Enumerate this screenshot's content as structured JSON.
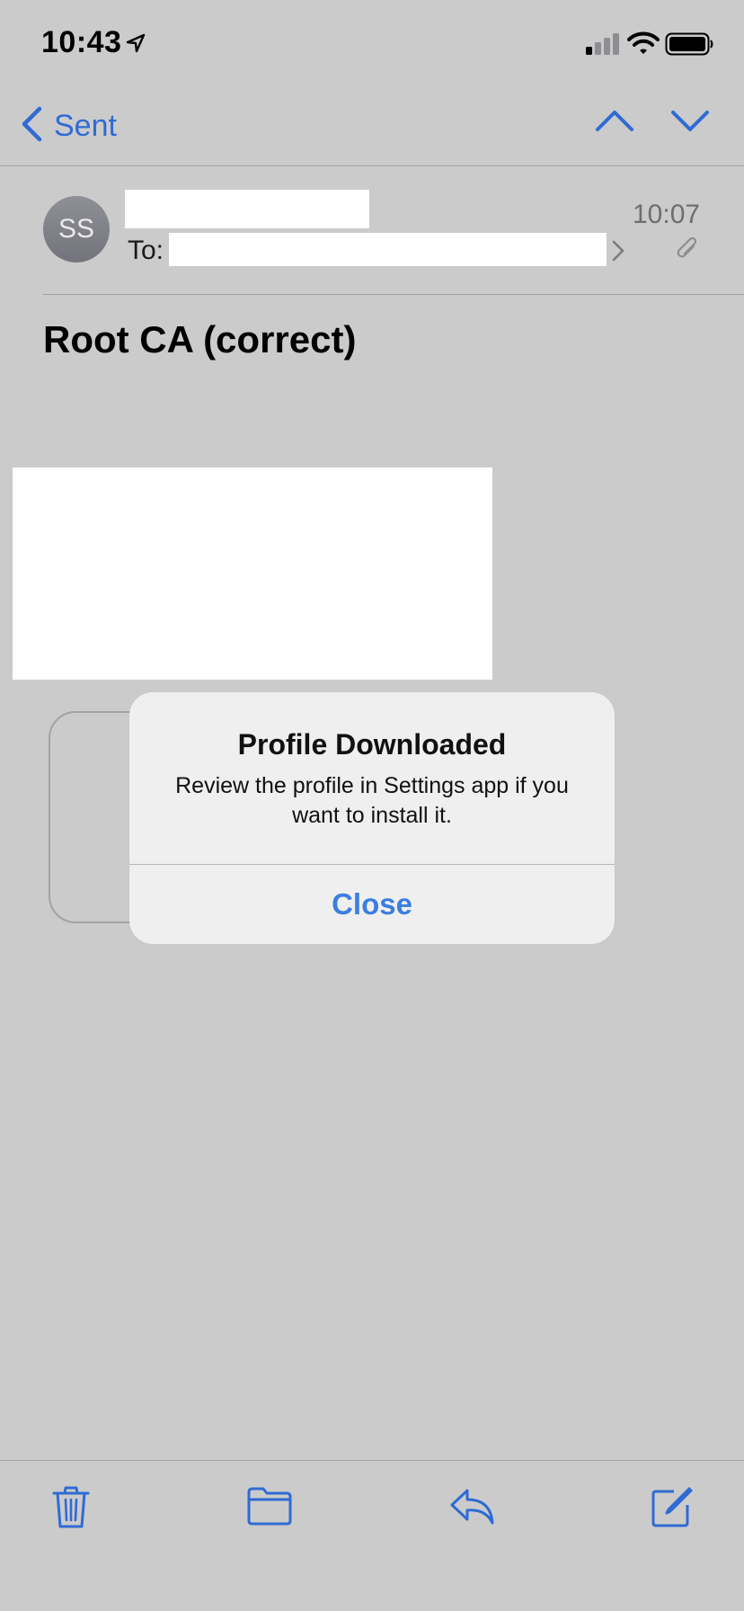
{
  "status_bar": {
    "time": "10:43",
    "icons": [
      "location-arrow-icon",
      "cellular-signal-icon",
      "wifi-icon",
      "battery-icon"
    ]
  },
  "nav": {
    "back_label": "Sent",
    "icons": [
      "chevron-left-icon",
      "chevron-up-icon",
      "chevron-down-icon"
    ]
  },
  "message": {
    "avatar_initials": "SS",
    "to_label": "To:",
    "time": "10:07",
    "subject": "Root CA (correct)",
    "has_attachment": true
  },
  "alert": {
    "title": "Profile Downloaded",
    "message": "Review the profile in Settings app if you want to install it.",
    "button": "Close"
  },
  "toolbar": {
    "icons": [
      "trash-icon",
      "folder-icon",
      "reply-icon",
      "compose-icon"
    ]
  },
  "colors": {
    "accent": "#2f6bd3",
    "background": "#cbcbcc",
    "alert_button": "#3b7ee0"
  }
}
